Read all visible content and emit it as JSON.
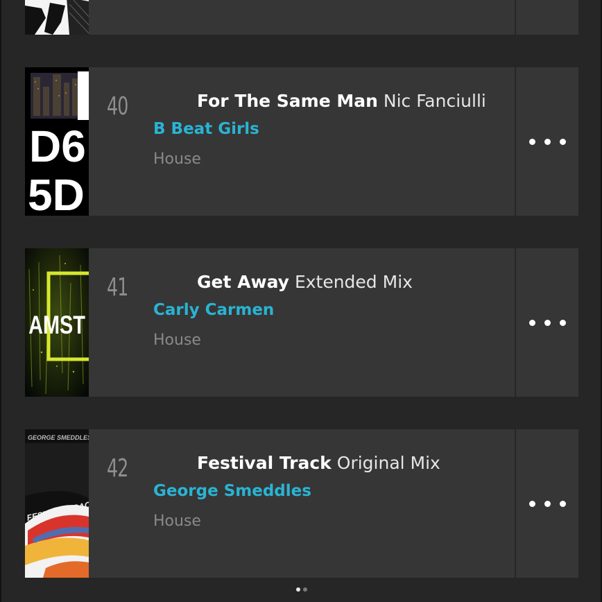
{
  "tracks": [
    {
      "rank": "",
      "title": "",
      "mix": "",
      "artist": "",
      "genre": ""
    },
    {
      "rank": "40",
      "title": "For The Same Man",
      "mix": "Nic Fanciulli",
      "artist": "B Beat Girls",
      "genre": "House"
    },
    {
      "rank": "41",
      "title": "Get Away",
      "mix": "Extended Mix",
      "artist": "Carly Carmen",
      "genre": "House"
    },
    {
      "rank": "42",
      "title": "Festival Track",
      "mix": "Original Mix",
      "artist": "George Smeddles",
      "genre": "House"
    }
  ],
  "artwork": [
    {
      "name": "previous-track-artwork"
    },
    {
      "name": "d5-artwork",
      "text": [
        "D6",
        "5D"
      ]
    },
    {
      "name": "amsterdam-artwork",
      "text": "AMST"
    },
    {
      "name": "festival-track-artwork",
      "text": [
        "GEORGE SMEDDLES",
        "FESTIVAL TRACK"
      ]
    }
  ],
  "more_icon": "ellipsis-icon",
  "pager": {
    "pages": 2,
    "current": 1
  },
  "colors": {
    "background": "#262626",
    "card": "#363636",
    "artist": "#29b4d4"
  }
}
